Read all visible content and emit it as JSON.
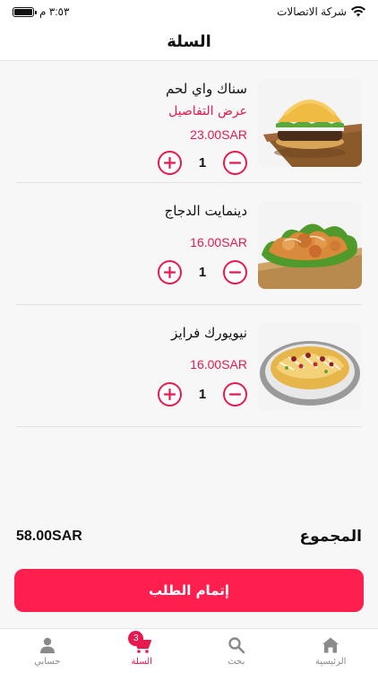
{
  "status_bar": {
    "carrier": "شركة الاتصالات",
    "time": "٣:٥٣ م"
  },
  "header": {
    "title": "السلة"
  },
  "cart": {
    "items": [
      {
        "name": "سناك واي لحم",
        "details_link": "عرض التفاصيل",
        "price": "23.00SAR",
        "quantity": "1",
        "image": "burger-image"
      },
      {
        "name": "دينمايت الدجاج",
        "price": "16.00SAR",
        "quantity": "1",
        "image": "dynamite-chicken-image"
      },
      {
        "name": "نيويورك فرايز",
        "price": "16.00SAR",
        "quantity": "1",
        "image": "fries-image"
      }
    ]
  },
  "summary": {
    "total_label": "المجموع",
    "total_amount": "58.00SAR"
  },
  "checkout": {
    "label": "إتمام الطلب"
  },
  "tabbar": {
    "tabs": [
      {
        "label": "الرئيسية",
        "icon": "home-icon"
      },
      {
        "label": "بحث",
        "icon": "search-icon"
      },
      {
        "label": "السلة",
        "icon": "cart-icon",
        "badge": "3",
        "active": true
      },
      {
        "label": "حسابي",
        "icon": "user-icon"
      }
    ]
  },
  "colors": {
    "accent": "#e8194e",
    "button": "#ff1f4f"
  }
}
